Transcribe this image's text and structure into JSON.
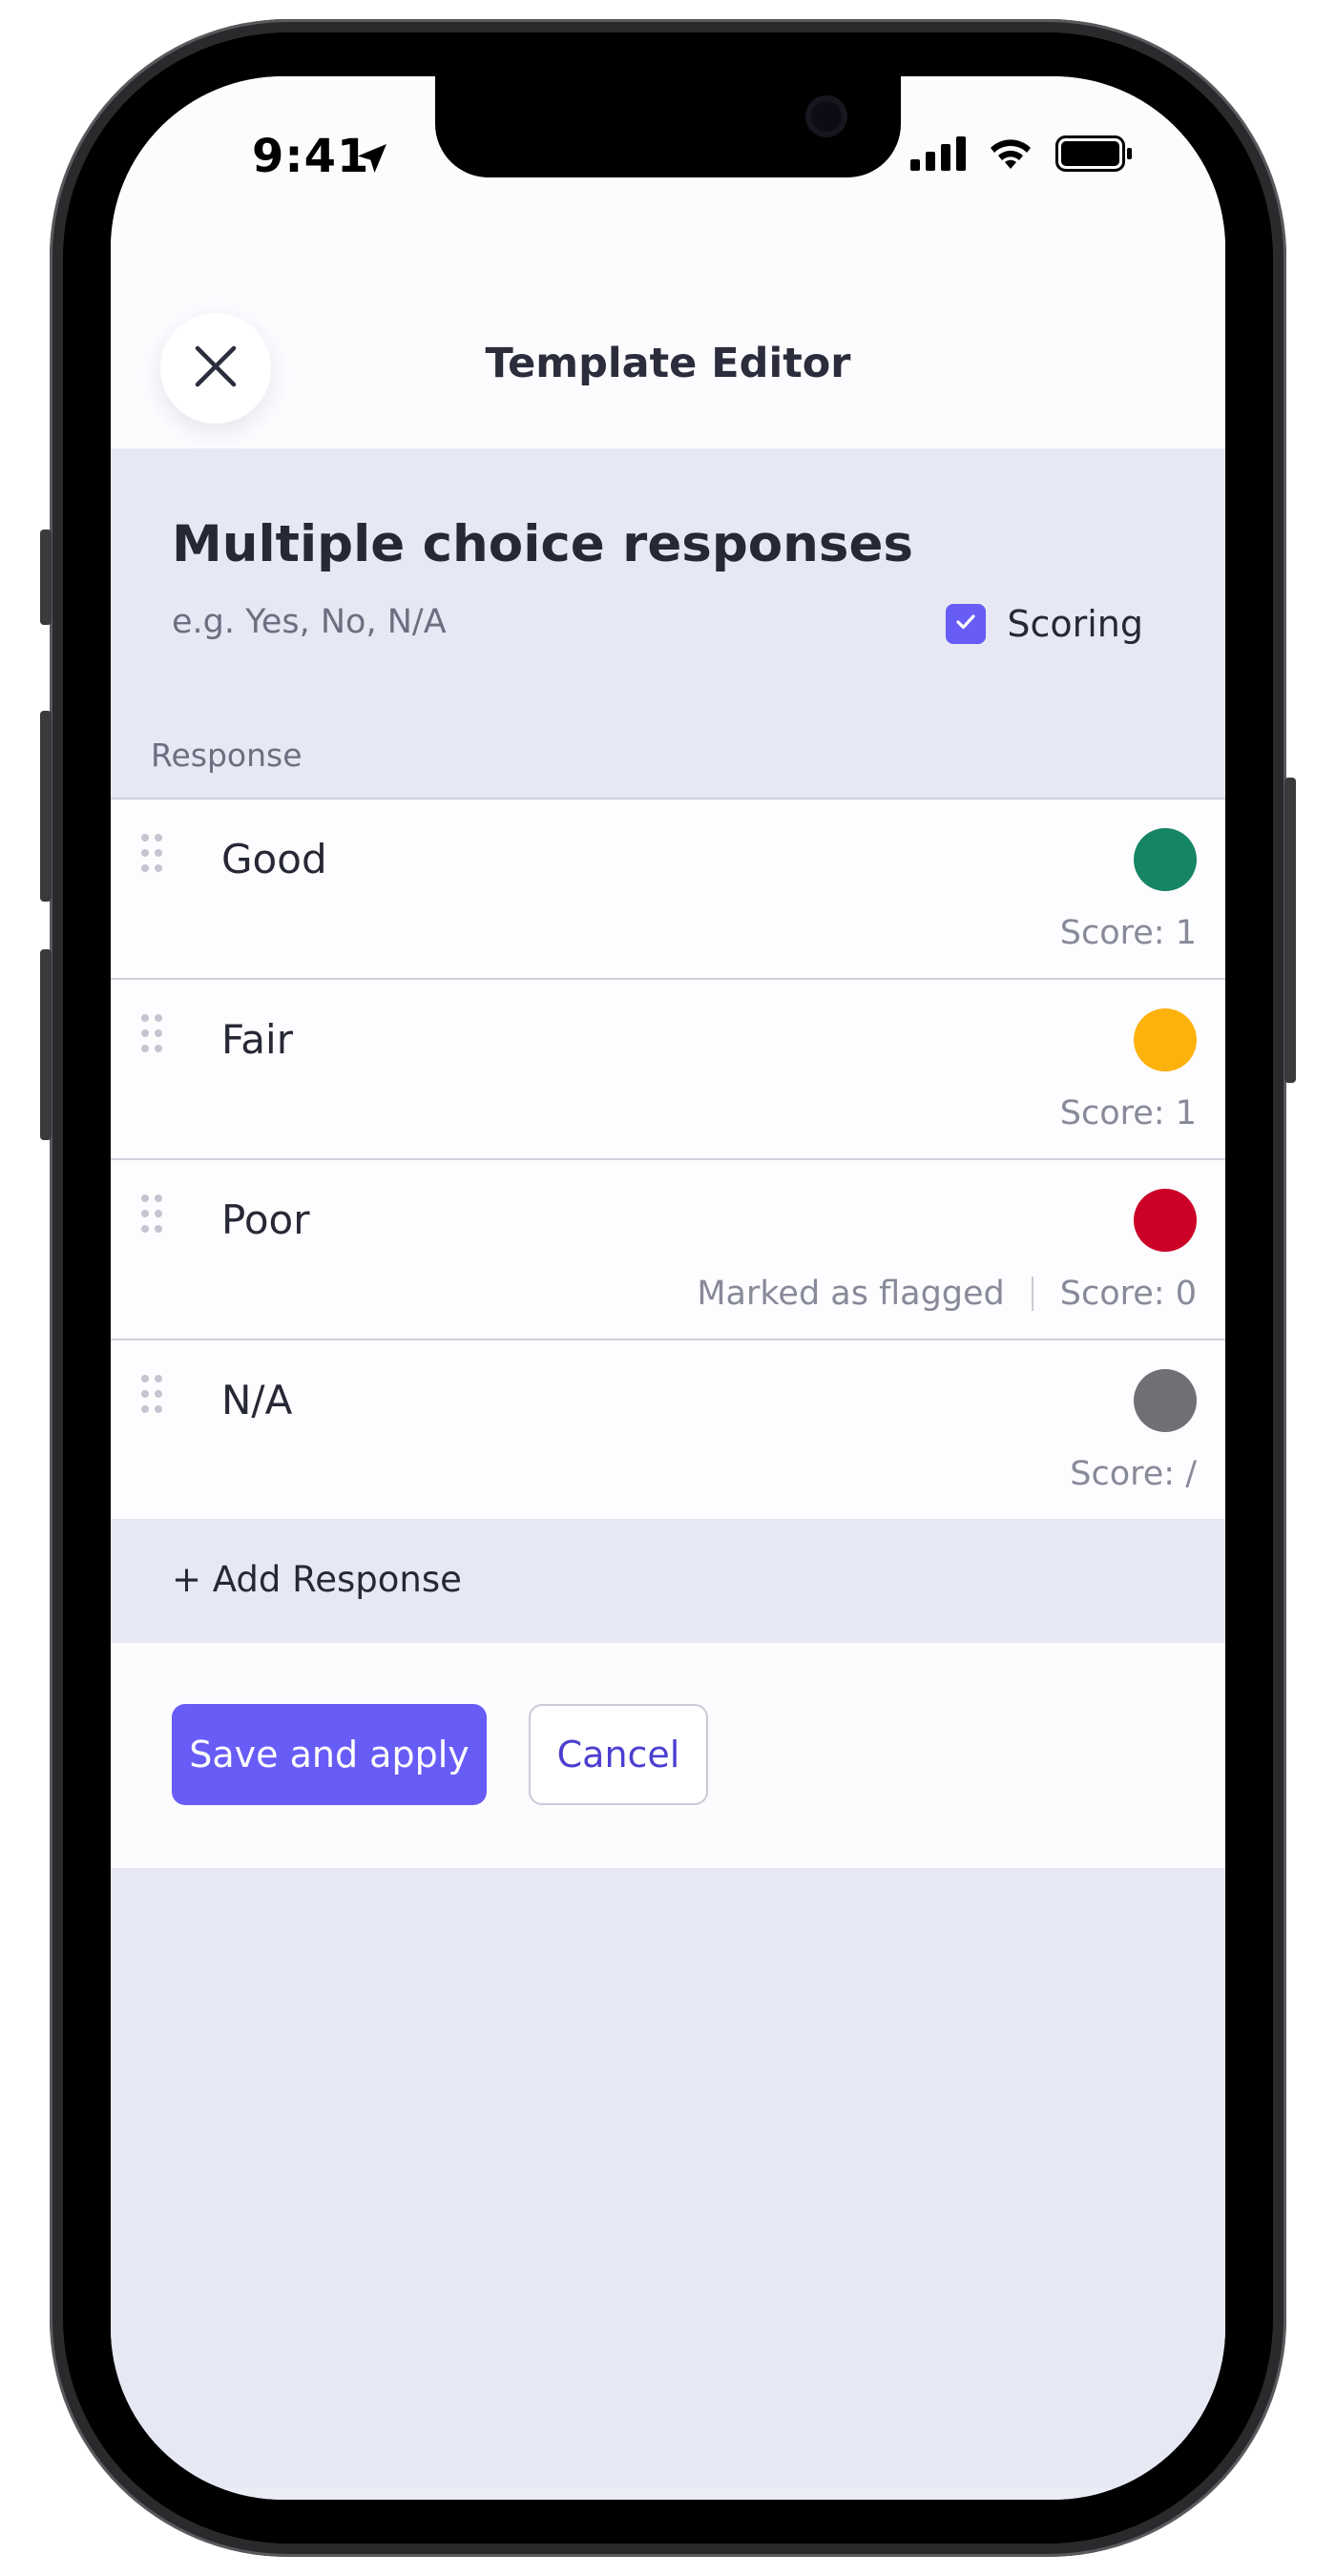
{
  "status_bar": {
    "time": "9:41"
  },
  "header": {
    "title": "Template Editor"
  },
  "section": {
    "title": "Multiple choice responses",
    "hint": "e.g. Yes, No, N/A",
    "scoring_label": "Scoring",
    "scoring_checked": true,
    "column_header": "Response"
  },
  "responses": [
    {
      "label": "Good",
      "color": "#168563",
      "flag_text": "",
      "score": "Score: 1"
    },
    {
      "label": "Fair",
      "color": "#fdb10b",
      "flag_text": "",
      "score": "Score: 1"
    },
    {
      "label": "Poor",
      "color": "#cc0128",
      "flag_text": "Marked as flagged",
      "score": "Score: 0"
    },
    {
      "label": "N/A",
      "color": "#707074",
      "flag_text": "",
      "score": "Score: /"
    }
  ],
  "add_response_label": "+ Add Response",
  "actions": {
    "save_label": "Save and apply",
    "cancel_label": "Cancel"
  },
  "icons": {
    "location": "location-arrow-icon",
    "signal": "cellular-signal-icon",
    "wifi": "wifi-icon",
    "battery": "battery-icon",
    "close": "close-icon",
    "drag": "drag-handle-icon",
    "check": "checkmark-icon"
  }
}
